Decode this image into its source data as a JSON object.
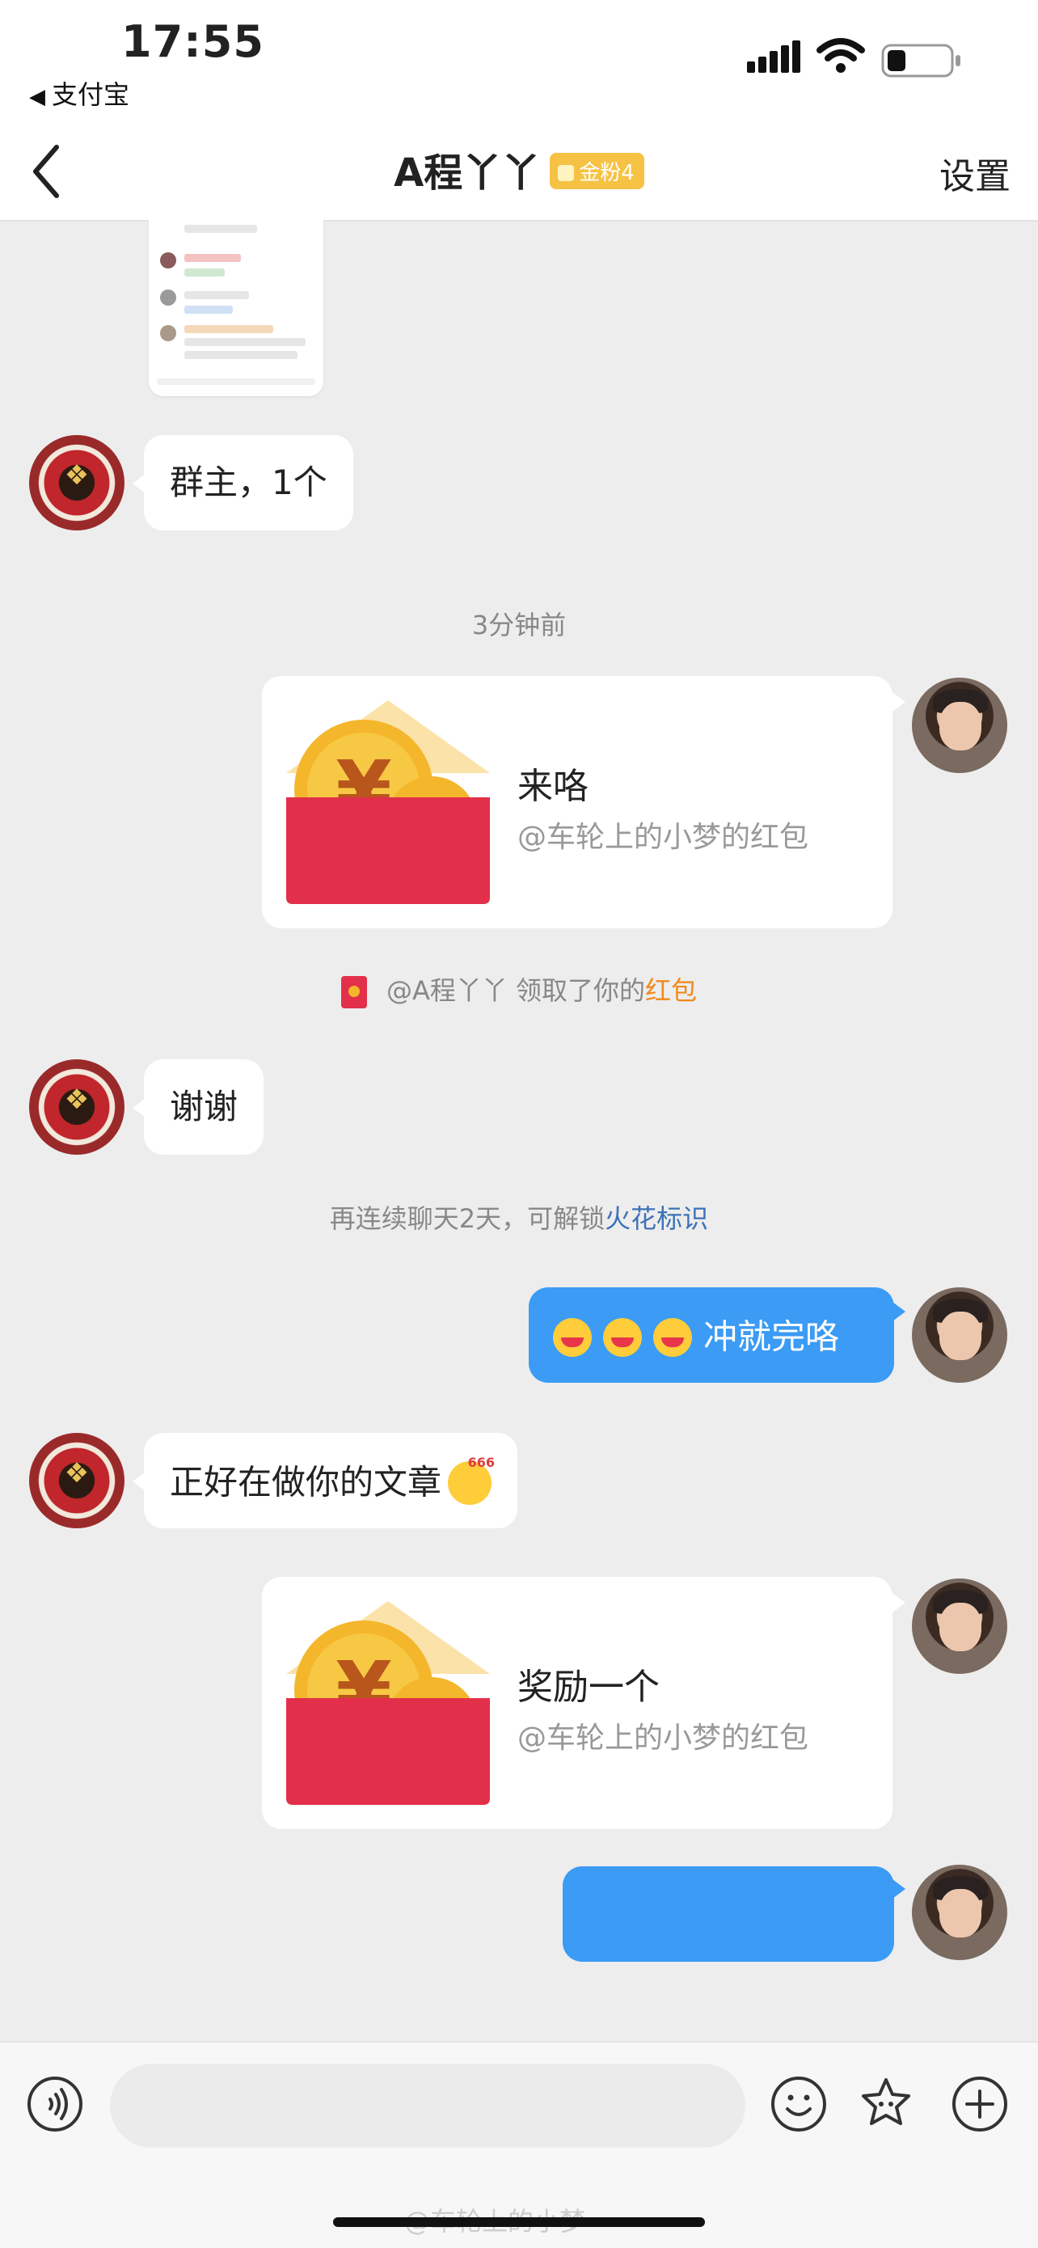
{
  "status_bar": {
    "time": "17:55",
    "back_app": "支付宝"
  },
  "nav": {
    "title": "A程丫丫",
    "badge": "金粉4",
    "settings": "设置"
  },
  "messages": {
    "m1_text": "群主，1个",
    "timestamp": "3分钟前",
    "redpacket1": {
      "title": "来咯",
      "sub": "@车轮上的小梦的红包"
    },
    "claim_notice": {
      "prefix": "@A程丫丫 领取了你的",
      "link": "红包"
    },
    "m2_text": "谢谢",
    "streak_notice": {
      "prefix": "再连续聊天2天，可解锁",
      "link": "火花标识"
    },
    "m3_text": "冲就完咯",
    "m4_text": "正好在做你的文章",
    "m4_emoji_text": "666",
    "redpacket2": {
      "title": "奖励一个",
      "sub": "@车轮上的小梦的红包"
    }
  },
  "watermark": "@车轮上的小梦",
  "icons": {
    "voice": "voice-icon",
    "emoji": "emoji-icon",
    "sticker": "sticker-icon",
    "plus": "plus-icon"
  },
  "colors": {
    "my_bubble": "#3b9bf5",
    "red_packet": "#e3304a",
    "coin": "#f4b62b",
    "link_blue": "#3d72b8",
    "link_orange": "#f08a1c"
  }
}
